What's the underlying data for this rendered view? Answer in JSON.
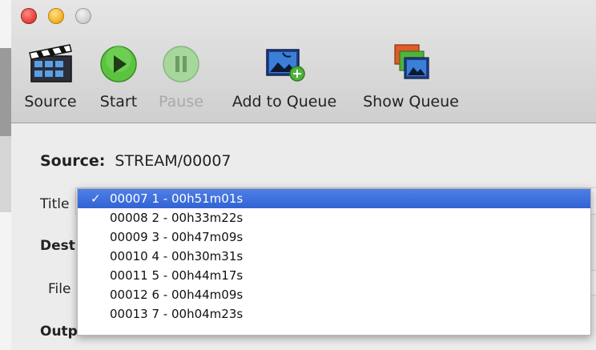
{
  "toolbar": {
    "buttons": [
      {
        "label": "Source",
        "icon": "clapperboard-icon",
        "enabled": true
      },
      {
        "label": "Start",
        "icon": "play-icon",
        "enabled": true
      },
      {
        "label": "Pause",
        "icon": "pause-icon",
        "enabled": false
      },
      {
        "label": "Add to Queue",
        "icon": "add-to-queue-icon",
        "enabled": true
      },
      {
        "label": "Show Queue",
        "icon": "show-queue-icon",
        "enabled": true
      }
    ]
  },
  "source": {
    "label": "Source:",
    "value": "STREAM/00007"
  },
  "title": {
    "label": "Title",
    "options": [
      {
        "text": "00007 1 - 00h51m01s",
        "selected": true
      },
      {
        "text": "00008 2 - 00h33m22s",
        "selected": false
      },
      {
        "text": "00009 3 - 00h47m09s",
        "selected": false
      },
      {
        "text": "00010 4 - 00h30m31s",
        "selected": false
      },
      {
        "text": "00011 5 - 00h44m17s",
        "selected": false
      },
      {
        "text": "00012 6 - 00h44m09s",
        "selected": false
      },
      {
        "text": "00013 7 - 00h04m23s",
        "selected": false
      }
    ],
    "check_mark": "✓"
  },
  "destination": {
    "label": "Dest"
  },
  "file": {
    "label": "File"
  },
  "output": {
    "label": "Outp"
  },
  "colors": {
    "selection": "#3c6fdc",
    "toolbar_bg": "#d9d9d9"
  }
}
